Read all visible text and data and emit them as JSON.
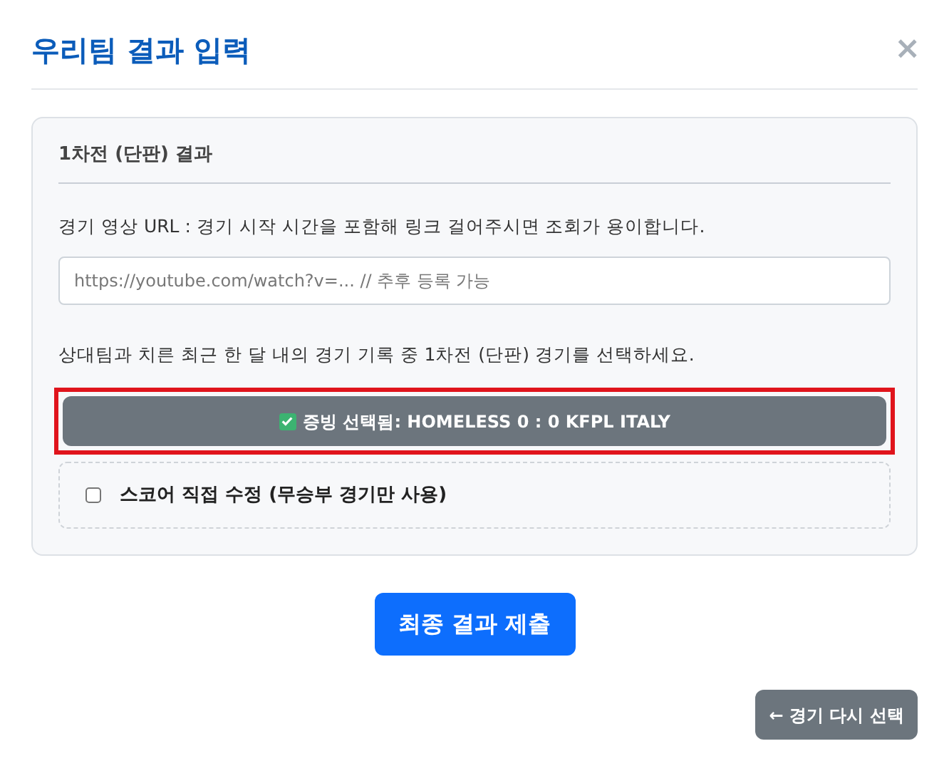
{
  "dialog": {
    "title": "우리팀 결과 입력",
    "close": "×"
  },
  "section": {
    "heading": "1차전 (단판) 결과",
    "url_label": "경기 영상 URL : 경기 시작 시간을 포함해 링크 걸어주시면 조회가 용이합니다.",
    "url_field": {
      "placeholder": "https://youtube.com/watch?v=... // 추후 등록 가능"
    },
    "instruction": "상대팀과 치른 최근 한 달 내의 경기 기록 중 1차전 (단판) 경기를 선택하세요.",
    "selected_match": {
      "label": "증빙 선택됨: HOMELESS 0 : 0 KFPL ITALY",
      "checked": true,
      "highlighted": true
    },
    "manual_edit": {
      "label": "스코어 직접 수정 (무승부 경기만 사용)",
      "checked": false
    }
  },
  "buttons": [
    {
      "kind": "primary",
      "label": "최종 결과 제출"
    },
    {
      "kind": "secondary",
      "label": "← 경기 다시 선택"
    }
  ]
}
